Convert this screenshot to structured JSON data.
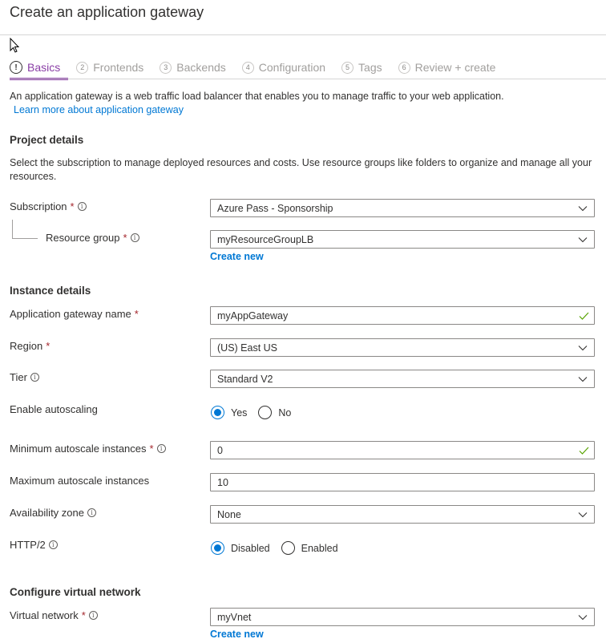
{
  "title": "Create an application gateway",
  "tabs": [
    {
      "num": "!",
      "label": "Basics",
      "active": true
    },
    {
      "num": "2",
      "label": "Frontends"
    },
    {
      "num": "3",
      "label": "Backends"
    },
    {
      "num": "4",
      "label": "Configuration"
    },
    {
      "num": "5",
      "label": "Tags"
    },
    {
      "num": "6",
      "label": "Review + create"
    }
  ],
  "intro": {
    "text": "An application gateway is a web traffic load balancer that enables you to manage traffic to your web application.",
    "link": "Learn more about application gateway"
  },
  "project": {
    "heading": "Project details",
    "description": "Select the subscription to manage deployed resources and costs. Use resource groups like folders to organize and manage all your resources.",
    "subscription": {
      "label": "Subscription",
      "required": "*",
      "value": "Azure Pass - Sponsorship"
    },
    "resource_group": {
      "label": "Resource group",
      "required": "*",
      "value": "myResourceGroupLB",
      "create_new": "Create new"
    }
  },
  "instance": {
    "heading": "Instance details",
    "name": {
      "label": "Application gateway name",
      "required": "*",
      "value": "myAppGateway"
    },
    "region": {
      "label": "Region",
      "required": "*",
      "value": "(US) East US"
    },
    "tier": {
      "label": "Tier",
      "value": "Standard V2"
    },
    "autoscaling": {
      "label": "Enable autoscaling",
      "options": [
        "Yes",
        "No"
      ],
      "selected": "Yes"
    },
    "min_instances": {
      "label": "Minimum autoscale instances",
      "required": "*",
      "value": "0"
    },
    "max_instances": {
      "label": "Maximum autoscale instances",
      "value": "10"
    },
    "availability_zone": {
      "label": "Availability zone",
      "value": "None"
    },
    "http2": {
      "label": "HTTP/2",
      "options": [
        "Disabled",
        "Enabled"
      ],
      "selected": "Disabled"
    }
  },
  "vnet": {
    "heading": "Configure virtual network",
    "network": {
      "label": "Virtual network",
      "required": "*",
      "value": "myVnet",
      "create_new": "Create new"
    }
  },
  "icons": {
    "info": "i"
  },
  "colors": {
    "accent": "#8a3ea6",
    "link": "#0078d4",
    "required": "#a4262c",
    "valid": "#57a300"
  }
}
